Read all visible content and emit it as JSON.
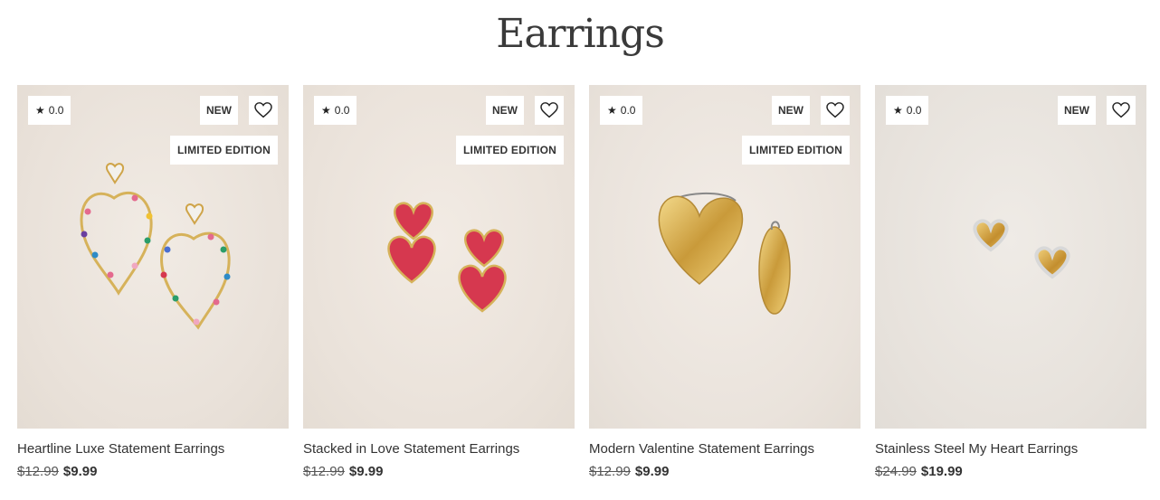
{
  "page": {
    "title": "Earrings"
  },
  "colors": {
    "accent_red": "#d6384f",
    "gold": "#d8a83c",
    "text": "#333333"
  },
  "products": [
    {
      "rating": "0.0",
      "badges": {
        "new": "NEW",
        "limited": "LIMITED EDITION"
      },
      "name": "Heartline Luxe Statement Earrings",
      "price_old": "$12.99",
      "price_new": "$9.99",
      "icon": "heart-outline-icon"
    },
    {
      "rating": "0.0",
      "badges": {
        "new": "NEW",
        "limited": "LIMITED EDITION"
      },
      "name": "Stacked in Love Statement Earrings",
      "price_old": "$12.99",
      "price_new": "$9.99",
      "icon": "heart-outline-icon"
    },
    {
      "rating": "0.0",
      "badges": {
        "new": "NEW",
        "limited": "LIMITED EDITION"
      },
      "name": "Modern Valentine Statement Earrings",
      "price_old": "$12.99",
      "price_new": "$9.99",
      "icon": "heart-outline-icon"
    },
    {
      "rating": "0.0",
      "badges": {
        "new": "NEW"
      },
      "name": "Stainless Steel My Heart Earrings",
      "price_old": "$24.99",
      "price_new": "$19.99",
      "icon": "heart-outline-icon"
    }
  ]
}
